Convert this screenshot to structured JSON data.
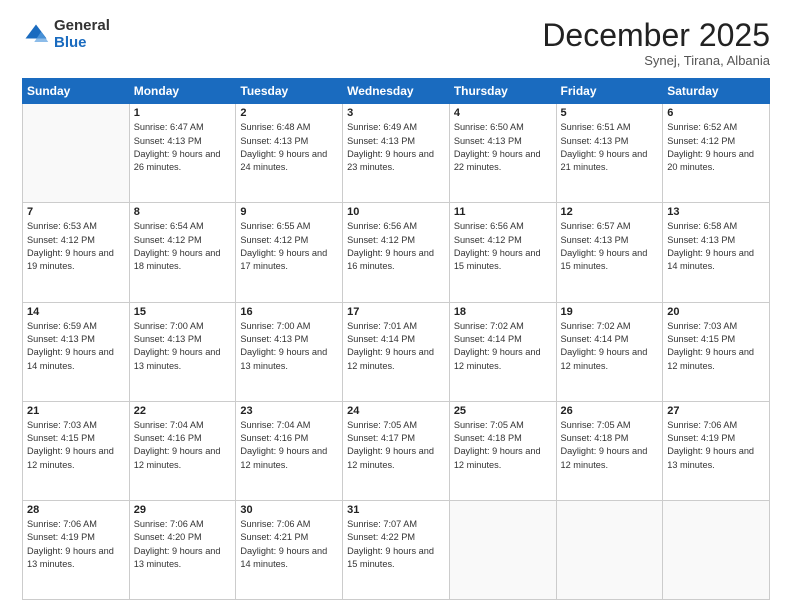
{
  "logo": {
    "general": "General",
    "blue": "Blue"
  },
  "header": {
    "month": "December 2025",
    "location": "Synej, Tirana, Albania"
  },
  "weekdays": [
    "Sunday",
    "Monday",
    "Tuesday",
    "Wednesday",
    "Thursday",
    "Friday",
    "Saturday"
  ],
  "weeks": [
    [
      {
        "day": "",
        "sunrise": "",
        "sunset": "",
        "daylight": ""
      },
      {
        "day": "1",
        "sunrise": "Sunrise: 6:47 AM",
        "sunset": "Sunset: 4:13 PM",
        "daylight": "Daylight: 9 hours and 26 minutes."
      },
      {
        "day": "2",
        "sunrise": "Sunrise: 6:48 AM",
        "sunset": "Sunset: 4:13 PM",
        "daylight": "Daylight: 9 hours and 24 minutes."
      },
      {
        "day": "3",
        "sunrise": "Sunrise: 6:49 AM",
        "sunset": "Sunset: 4:13 PM",
        "daylight": "Daylight: 9 hours and 23 minutes."
      },
      {
        "day": "4",
        "sunrise": "Sunrise: 6:50 AM",
        "sunset": "Sunset: 4:13 PM",
        "daylight": "Daylight: 9 hours and 22 minutes."
      },
      {
        "day": "5",
        "sunrise": "Sunrise: 6:51 AM",
        "sunset": "Sunset: 4:13 PM",
        "daylight": "Daylight: 9 hours and 21 minutes."
      },
      {
        "day": "6",
        "sunrise": "Sunrise: 6:52 AM",
        "sunset": "Sunset: 4:12 PM",
        "daylight": "Daylight: 9 hours and 20 minutes."
      }
    ],
    [
      {
        "day": "7",
        "sunrise": "Sunrise: 6:53 AM",
        "sunset": "Sunset: 4:12 PM",
        "daylight": "Daylight: 9 hours and 19 minutes."
      },
      {
        "day": "8",
        "sunrise": "Sunrise: 6:54 AM",
        "sunset": "Sunset: 4:12 PM",
        "daylight": "Daylight: 9 hours and 18 minutes."
      },
      {
        "day": "9",
        "sunrise": "Sunrise: 6:55 AM",
        "sunset": "Sunset: 4:12 PM",
        "daylight": "Daylight: 9 hours and 17 minutes."
      },
      {
        "day": "10",
        "sunrise": "Sunrise: 6:56 AM",
        "sunset": "Sunset: 4:12 PM",
        "daylight": "Daylight: 9 hours and 16 minutes."
      },
      {
        "day": "11",
        "sunrise": "Sunrise: 6:56 AM",
        "sunset": "Sunset: 4:12 PM",
        "daylight": "Daylight: 9 hours and 15 minutes."
      },
      {
        "day": "12",
        "sunrise": "Sunrise: 6:57 AM",
        "sunset": "Sunset: 4:13 PM",
        "daylight": "Daylight: 9 hours and 15 minutes."
      },
      {
        "day": "13",
        "sunrise": "Sunrise: 6:58 AM",
        "sunset": "Sunset: 4:13 PM",
        "daylight": "Daylight: 9 hours and 14 minutes."
      }
    ],
    [
      {
        "day": "14",
        "sunrise": "Sunrise: 6:59 AM",
        "sunset": "Sunset: 4:13 PM",
        "daylight": "Daylight: 9 hours and 14 minutes."
      },
      {
        "day": "15",
        "sunrise": "Sunrise: 7:00 AM",
        "sunset": "Sunset: 4:13 PM",
        "daylight": "Daylight: 9 hours and 13 minutes."
      },
      {
        "day": "16",
        "sunrise": "Sunrise: 7:00 AM",
        "sunset": "Sunset: 4:13 PM",
        "daylight": "Daylight: 9 hours and 13 minutes."
      },
      {
        "day": "17",
        "sunrise": "Sunrise: 7:01 AM",
        "sunset": "Sunset: 4:14 PM",
        "daylight": "Daylight: 9 hours and 12 minutes."
      },
      {
        "day": "18",
        "sunrise": "Sunrise: 7:02 AM",
        "sunset": "Sunset: 4:14 PM",
        "daylight": "Daylight: 9 hours and 12 minutes."
      },
      {
        "day": "19",
        "sunrise": "Sunrise: 7:02 AM",
        "sunset": "Sunset: 4:14 PM",
        "daylight": "Daylight: 9 hours and 12 minutes."
      },
      {
        "day": "20",
        "sunrise": "Sunrise: 7:03 AM",
        "sunset": "Sunset: 4:15 PM",
        "daylight": "Daylight: 9 hours and 12 minutes."
      }
    ],
    [
      {
        "day": "21",
        "sunrise": "Sunrise: 7:03 AM",
        "sunset": "Sunset: 4:15 PM",
        "daylight": "Daylight: 9 hours and 12 minutes."
      },
      {
        "day": "22",
        "sunrise": "Sunrise: 7:04 AM",
        "sunset": "Sunset: 4:16 PM",
        "daylight": "Daylight: 9 hours and 12 minutes."
      },
      {
        "day": "23",
        "sunrise": "Sunrise: 7:04 AM",
        "sunset": "Sunset: 4:16 PM",
        "daylight": "Daylight: 9 hours and 12 minutes."
      },
      {
        "day": "24",
        "sunrise": "Sunrise: 7:05 AM",
        "sunset": "Sunset: 4:17 PM",
        "daylight": "Daylight: 9 hours and 12 minutes."
      },
      {
        "day": "25",
        "sunrise": "Sunrise: 7:05 AM",
        "sunset": "Sunset: 4:18 PM",
        "daylight": "Daylight: 9 hours and 12 minutes."
      },
      {
        "day": "26",
        "sunrise": "Sunrise: 7:05 AM",
        "sunset": "Sunset: 4:18 PM",
        "daylight": "Daylight: 9 hours and 12 minutes."
      },
      {
        "day": "27",
        "sunrise": "Sunrise: 7:06 AM",
        "sunset": "Sunset: 4:19 PM",
        "daylight": "Daylight: 9 hours and 13 minutes."
      }
    ],
    [
      {
        "day": "28",
        "sunrise": "Sunrise: 7:06 AM",
        "sunset": "Sunset: 4:19 PM",
        "daylight": "Daylight: 9 hours and 13 minutes."
      },
      {
        "day": "29",
        "sunrise": "Sunrise: 7:06 AM",
        "sunset": "Sunset: 4:20 PM",
        "daylight": "Daylight: 9 hours and 13 minutes."
      },
      {
        "day": "30",
        "sunrise": "Sunrise: 7:06 AM",
        "sunset": "Sunset: 4:21 PM",
        "daylight": "Daylight: 9 hours and 14 minutes."
      },
      {
        "day": "31",
        "sunrise": "Sunrise: 7:07 AM",
        "sunset": "Sunset: 4:22 PM",
        "daylight": "Daylight: 9 hours and 15 minutes."
      },
      {
        "day": "",
        "sunrise": "",
        "sunset": "",
        "daylight": ""
      },
      {
        "day": "",
        "sunrise": "",
        "sunset": "",
        "daylight": ""
      },
      {
        "day": "",
        "sunrise": "",
        "sunset": "",
        "daylight": ""
      }
    ]
  ]
}
